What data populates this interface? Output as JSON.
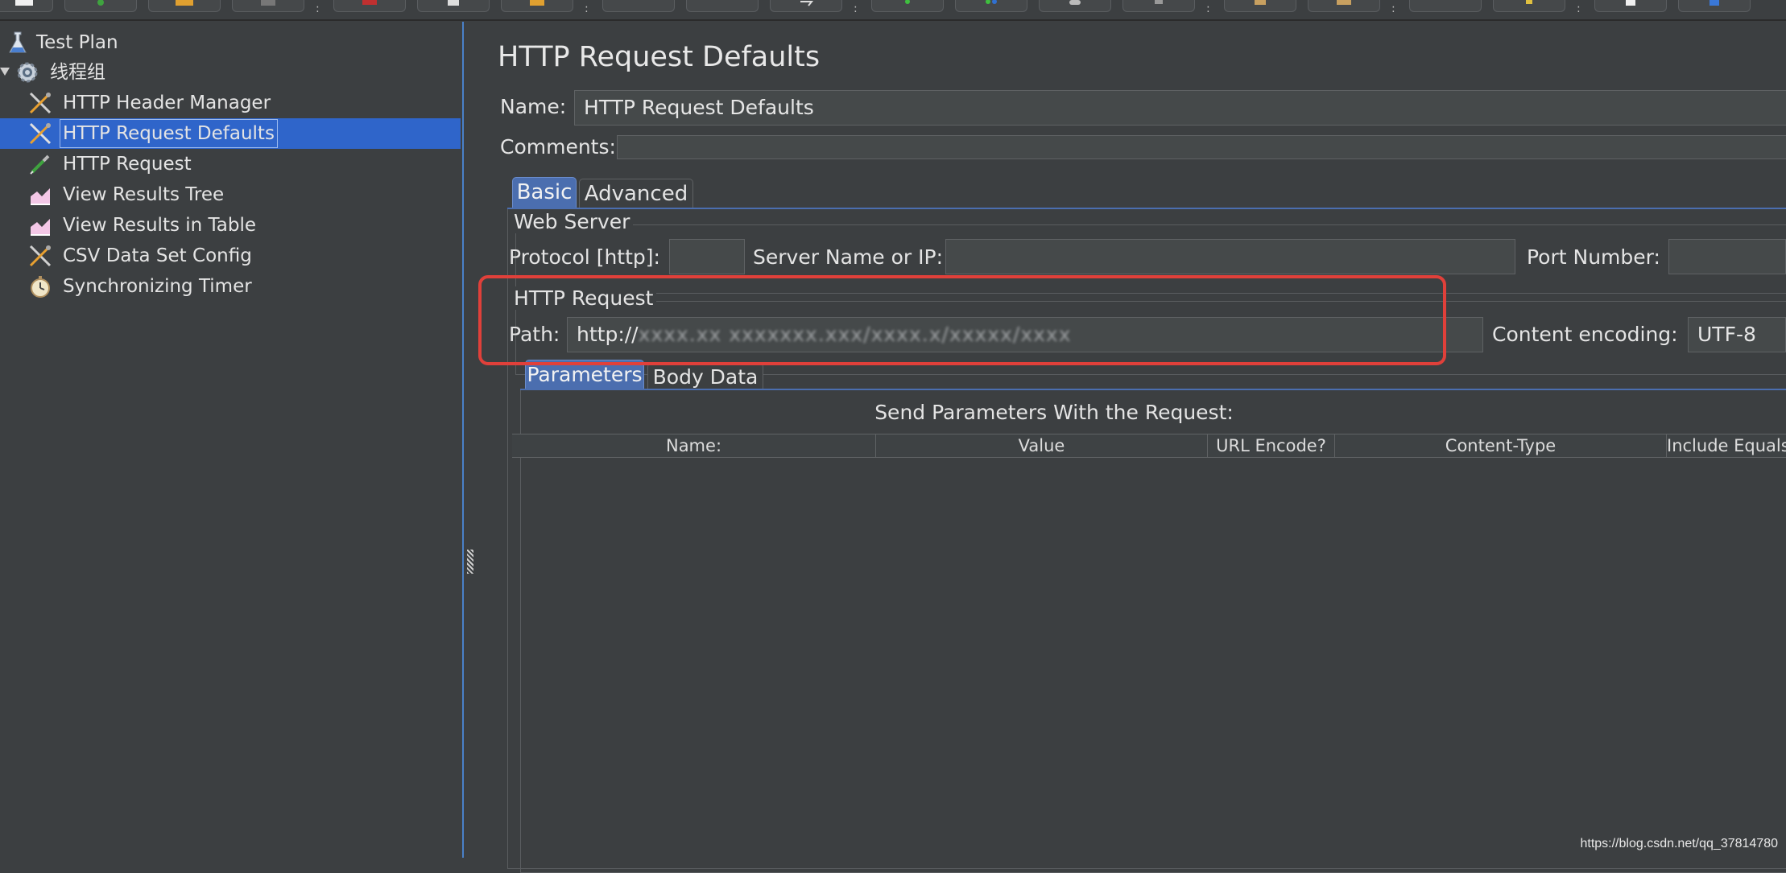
{
  "tree": {
    "items": [
      {
        "label": "Test Plan",
        "icon": "flask-icon"
      },
      {
        "label": "线程组",
        "icon": "gear-icon"
      },
      {
        "label": "HTTP Header Manager",
        "icon": "wrench-screwdriver-icon"
      },
      {
        "label": "HTTP Request Defaults",
        "icon": "wrench-screwdriver-icon",
        "selected": true
      },
      {
        "label": "HTTP Request",
        "icon": "pipette-icon"
      },
      {
        "label": "View Results Tree",
        "icon": "graph-icon"
      },
      {
        "label": "View Results in Table",
        "icon": "graph-icon"
      },
      {
        "label": "CSV Data Set Config",
        "icon": "wrench-screwdriver-icon"
      },
      {
        "label": "Synchronizing Timer",
        "icon": "stopwatch-icon"
      }
    ]
  },
  "editor": {
    "title": "HTTP Request Defaults",
    "name_label": "Name:",
    "name_value": "HTTP Request Defaults",
    "comments_label": "Comments:",
    "comments_value": "",
    "tabs": [
      "Basic",
      "Advanced"
    ],
    "web_server": {
      "title": "Web Server",
      "protocol_label": "Protocol [http]:",
      "protocol_value": "",
      "server_label": "Server Name or IP:",
      "server_value": "",
      "port_label": "Port Number:",
      "port_value": ""
    },
    "http_request": {
      "title": "HTTP Request",
      "path_label": "Path:",
      "path_prefix": "http://",
      "path_blurred": "xxxx.xx  xxxxxxx.xxx/xxxx.x/xxxxx/xxxx",
      "encoding_label": "Content encoding:",
      "encoding_value": "UTF-8"
    },
    "sub_tabs": [
      "Parameters",
      "Body Data"
    ],
    "params_header": "Send Parameters With the Request:",
    "columns": [
      "Name:",
      "Value",
      "URL Encode?",
      "Content-Type",
      "Include Equals?"
    ]
  },
  "watermark": "https://blog.csdn.net/qq_37814780",
  "colors": {
    "selection": "#2f65ca",
    "highlight_box": "#e0403a",
    "active_tab": "#4b6eaf"
  }
}
